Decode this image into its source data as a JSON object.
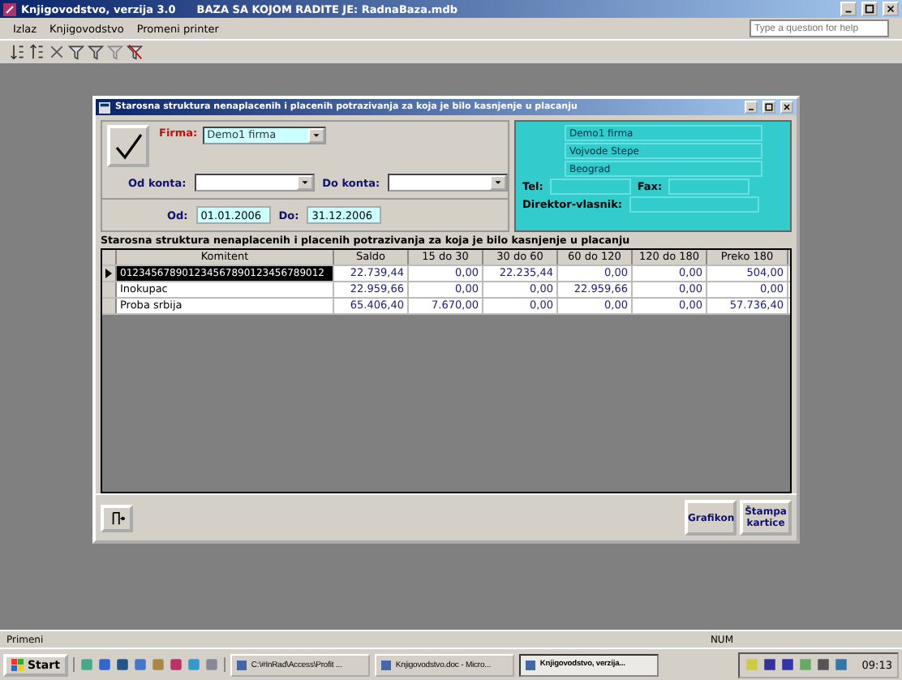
{
  "app_title": {
    "title": "Knjigovodstvo, verzija 3.0",
    "database": "BAZA SA KOJOM RADITE JE: RadnaBaza.mdb"
  },
  "menu": [
    "Izlaz",
    "Knjigovodstvo",
    "Promeni printer"
  ],
  "help_search": {
    "placeholder": "Type a question for help"
  },
  "form": {
    "title": "Starosna struktura nenaplacenih i placenih potrazivanja za koja je bilo kasnjenje u placanju",
    "firm": {
      "label": "Firma:",
      "value": "Demo1 firma"
    },
    "from_account": {
      "label": "Od konta:"
    },
    "to_account": {
      "label": "Do konta:"
    },
    "date_from": {
      "label": "Od:",
      "value": "01.01.2006"
    },
    "date_to": {
      "label": "Do:",
      "value": "31.12.2006"
    },
    "firm_info": {
      "name": "Demo1 firma",
      "street": "Vojvode Stepe",
      "city": "Beograd",
      "phone_label": "Tel:",
      "fax_label": "Fax:",
      "director_label": "Direktor-vlasnik:"
    },
    "table": {
      "caption": "Starosna struktura nenaplacenih i placenih potrazivanja za koja je bilo kasnjenje u placanju",
      "columns": [
        "Komitent",
        "Saldo",
        "15 do 30",
        "30 do 60",
        "60 do 120",
        "120 do 180",
        "Preko 180"
      ],
      "rows": [
        {
          "selected": true,
          "cells": [
            "012345678901234567890123456789012",
            "22.739,44",
            "0,00",
            "22.235,44",
            "0,00",
            "0,00",
            "504,00"
          ]
        },
        {
          "selected": false,
          "cells": [
            "Inokupac",
            "22.959,66",
            "0,00",
            "0,00",
            "22.959,66",
            "0,00",
            "0,00"
          ]
        },
        {
          "selected": false,
          "cells": [
            "Proba srbija",
            "65.406,40",
            "7.670,00",
            "0,00",
            "0,00",
            "0,00",
            "57.736,40"
          ]
        }
      ]
    },
    "buttons": [
      "Grafikon",
      "Štampa kartice"
    ]
  },
  "status_bar": {
    "left": "Primeni",
    "right": "NUM"
  },
  "taskbar": {
    "start": "Start",
    "tasks": [
      {
        "label": "C:\\#InRad\\Access\\Profit ...",
        "selected": false
      },
      {
        "label": "Knjigovodstvo.doc - Micro...",
        "selected": false
      },
      {
        "label": "Knjigovodstvo, verzija...",
        "selected": true
      }
    ],
    "clock": "09:13"
  }
}
